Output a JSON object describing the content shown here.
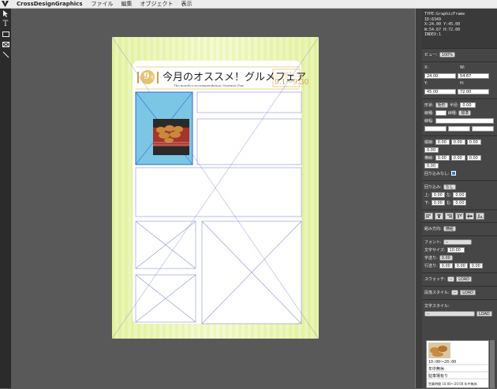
{
  "menu": {
    "app_name": "CrossDesignGraphics",
    "items": [
      "ファイル",
      "編集",
      "オブジェクト",
      "表示"
    ]
  },
  "doc": {
    "month": "9",
    "month_suffix": "月",
    "title": "今月のオススメ！グルメフェア",
    "subtitle": "The month's recommendation Gourmet Fair",
    "year": "2017",
    "dates": "9.1〜9.30"
  },
  "info": {
    "type": "TYPE:GraphicFrame",
    "id": "ID:6349",
    "xy": "X:24.00 Y:45.00",
    "wh": "W:54.67 H:72.00",
    "index": "INDEX:1"
  },
  "view": {
    "label": "ビュー:",
    "value": "100%"
  },
  "geom": {
    "x_label": "X:",
    "x": "24.00",
    "w_label": "W:",
    "w": "54.67",
    "y_label": "Y:",
    "y": "45.00",
    "h_label": "H:",
    "h": "72.00"
  },
  "shape": {
    "shape_label": "形状:",
    "shape_value": "矩形",
    "radius_label": "半径:",
    "radius_value": "0.00",
    "fill_label": "線種:",
    "fill_value": "",
    "line_label": "線種:",
    "line_value": "標準",
    "stroke_label": "線幅:"
  },
  "trim": {
    "label1": "縦線:",
    "v1": "0.00",
    "v2": "0.00",
    "v3": "0.00",
    "v4": "0.00",
    "label2": "横線:",
    "h1": "0.00",
    "h2": "0.00",
    "h3": "0.00",
    "h4": "0.00",
    "nowrap_label": "回り込みなし:"
  },
  "wrap": {
    "label": "回り込み:",
    "value": "なし",
    "top_label": "上:",
    "top": "0.00",
    "left_label": "左:",
    "left": "0.00",
    "right_label": "右:",
    "right": "0.00",
    "bottom_label": "下:",
    "bottom": "0.00"
  },
  "dir": {
    "label": "組み方向:",
    "value": "横組"
  },
  "font": {
    "font_label": "フォント:",
    "font_value": "--",
    "size_label": "文字サイズ:",
    "size_value": "10.00",
    "cp_label": "字送り:",
    "cp_value": "0.00",
    "lead_label": "行送り:",
    "lead1": "0.00",
    "lead2": "0.00",
    "lead3": "0.00"
  },
  "swatch": {
    "label": "スウォッチ:",
    "value": "--",
    "load": "LOAD"
  },
  "para": {
    "label": "段落スタイル:",
    "value": "--",
    "load": "LOAD"
  },
  "charstyle": {
    "label": "文字スタイル:",
    "value": "--",
    "load": "LOAD"
  },
  "thumb": {
    "line1": "10:00〜20:00",
    "line2": "年中無休",
    "line3": "駐車場有り",
    "line4": "営業時間 10:00〜20:00 年中無休"
  },
  "colors": {
    "accent": "#e8c36c",
    "selection": "#7bc6e4",
    "stripe_a": "#e3f1a5",
    "stripe_b": "#f4f9d4",
    "guide": "#8b8fe0"
  }
}
